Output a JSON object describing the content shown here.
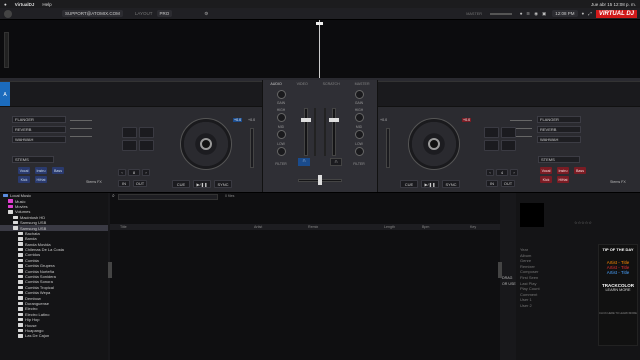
{
  "macbar": {
    "app": "VirtualDJ",
    "menu": "Help",
    "clock": "Jue abr 15  12:08 p. m."
  },
  "topbar": {
    "account": "SUPPORT@ATOMIX.COM",
    "layout_label": "LAYOUT",
    "layout_value": "PRO",
    "master_label": "MASTER",
    "time": "12:08 PM",
    "brand": "VIRTUAL DJ"
  },
  "mixer": {
    "tabs": [
      "AUDIO",
      "VIDEO",
      "SCRATCH",
      "MASTER"
    ],
    "left_knobs": [
      "HIGH",
      "MID",
      "LOW",
      "FILTER"
    ],
    "right_knobs": [
      "HIGH",
      "MID",
      "LOW",
      "FILTER"
    ],
    "gain": "GAIN",
    "headphones_icon": "headphones-icon",
    "crossfader": "crossfader"
  },
  "left_deck": {
    "fx": [
      "FLANGER",
      "REVERB",
      "WAHWAH"
    ],
    "sampler": "STEMS",
    "pads": [
      "Vocal",
      "Instru",
      "Bass",
      "Kick",
      "HiHat"
    ],
    "stems_fx": "Stems FX",
    "loop_value": "8",
    "in": "IN",
    "out": "OUT",
    "cue": "CUE",
    "play": "▶/❚❚",
    "sync": "SYNC",
    "key": "+0.0",
    "pitch": "+0.0"
  },
  "right_deck": {
    "fx": [
      "FLANGER",
      "REVERB",
      "WAHWAH"
    ],
    "sampler": "STEMS",
    "pads": [
      "Vocal",
      "Instru",
      "Bass",
      "Kick",
      "HiHat"
    ],
    "stems_fx": "Stems FX",
    "loop_value": "4",
    "in": "IN",
    "out": "OUT",
    "cue": "CUE",
    "play": "▶/❚❚",
    "sync": "SYNC",
    "key": "+0.0",
    "pitch": "+0.0"
  },
  "search": {
    "placeholder": "",
    "files_label": "0 files"
  },
  "folders": [
    {
      "label": "Local Music",
      "color": "#5b8de0",
      "indent": 0
    },
    {
      "label": "Music",
      "color": "#e040d0",
      "indent": 1
    },
    {
      "label": "Movies",
      "color": "#e040d0",
      "indent": 1
    },
    {
      "label": "Volumes",
      "color": "#d9d9d9",
      "indent": 1
    },
    {
      "label": "Macintosh HD",
      "color": "#d9d9d9",
      "indent": 2
    },
    {
      "label": "Samsung USB",
      "color": "#d9d9d9",
      "indent": 2
    },
    {
      "label": "Samsung USB",
      "color": "#d9d9d9",
      "indent": 2,
      "selected": true
    },
    {
      "label": "Bachata",
      "color": "#d9d9d9",
      "indent": 3
    },
    {
      "label": "Banda",
      "color": "#d9d9d9",
      "indent": 3
    },
    {
      "label": "Banda Movida",
      "color": "#d9d9d9",
      "indent": 3
    },
    {
      "label": "Chilenas De La Costa",
      "color": "#d9d9d9",
      "indent": 3
    },
    {
      "label": "Corridos",
      "color": "#d9d9d9",
      "indent": 3
    },
    {
      "label": "Cumbia",
      "color": "#d9d9d9",
      "indent": 3
    },
    {
      "label": "Cumbia Grupera",
      "color": "#d9d9d9",
      "indent": 3
    },
    {
      "label": "Cumbia Norteña",
      "color": "#d9d9d9",
      "indent": 3
    },
    {
      "label": "Cumbia Sonidera",
      "color": "#d9d9d9",
      "indent": 3
    },
    {
      "label": "Cumbia Sonora",
      "color": "#d9d9d9",
      "indent": 3
    },
    {
      "label": "Cumbia Tropical",
      "color": "#d9d9d9",
      "indent": 3
    },
    {
      "label": "Cumbia Wepa",
      "color": "#d9d9d9",
      "indent": 3
    },
    {
      "label": "Dembow",
      "color": "#d9d9d9",
      "indent": 3
    },
    {
      "label": "Duranguense",
      "color": "#d9d9d9",
      "indent": 3
    },
    {
      "label": "Electro",
      "color": "#d9d9d9",
      "indent": 3
    },
    {
      "label": "Electro Latino",
      "color": "#d9d9d9",
      "indent": 3
    },
    {
      "label": "Hip Hop",
      "color": "#d9d9d9",
      "indent": 3
    },
    {
      "label": "House",
      "color": "#d9d9d9",
      "indent": 3
    },
    {
      "label": "Huapango",
      "color": "#d9d9d9",
      "indent": 3
    },
    {
      "label": "Las De Cajon",
      "color": "#d9d9d9",
      "indent": 3
    }
  ],
  "columns": [
    "Title",
    "Artist",
    "Remix",
    "Length",
    "Bpm",
    "Key"
  ],
  "sidebar": {
    "drag_label": "DRAG",
    "drop_label": "OR USE"
  },
  "info": {
    "fields": [
      "Year",
      "Album",
      "Genre",
      "Remixer",
      "Composer",
      "First Seen",
      "Last Play",
      "Play Count",
      "Comment",
      "User 1",
      "User 2"
    ],
    "rating": "☆☆☆☆☆"
  },
  "ad": {
    "heading": "TIP OF THE DAY",
    "artist_title": "Artist - Title",
    "brand": "TRACKCOLOR",
    "cta": "LEARN MORE",
    "footer": "CLICK HERE TO LEARN MORE"
  }
}
